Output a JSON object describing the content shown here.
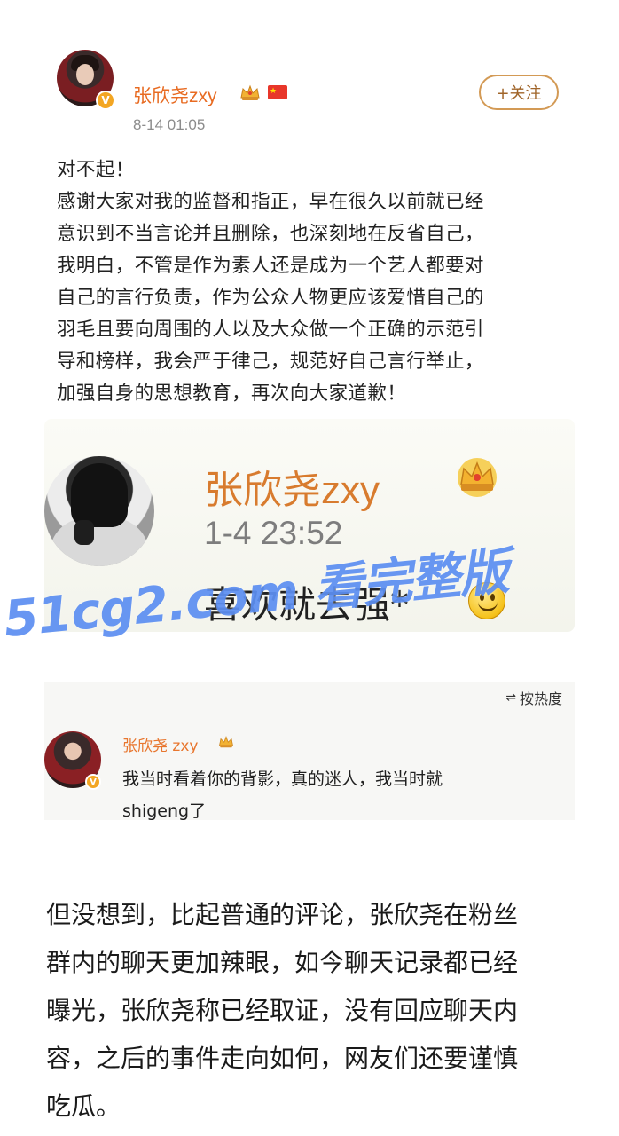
{
  "post": {
    "username": "张欣尧zxy",
    "timestamp": "8-14 01:05",
    "follow_label": "+关注",
    "verified_badge": "V",
    "crown_icon": "crown-icon",
    "flag_icon": "china-flag-icon",
    "body_lines": [
      "对不起！",
      "感谢大家对我的监督和指正，早在很久以前就已经",
      "意识到不当言论并且删除，也深刻地在反省自己，",
      "我明白，不管是作为素人还是成为一个艺人都要对",
      "自己的言行负责，作为公众人物更应该爱惜自己的",
      "羽毛且要向周围的人以及大众做一个正确的示范引",
      "导和榜样，我会严于律己，规范好自己言行举止，",
      "加强自身的思想教育，再次向大家道歉！"
    ]
  },
  "old_post": {
    "username": "张欣尧zxy",
    "timestamp": "1-4 23:52",
    "text": "喜欢就去强*"
  },
  "watermark": {
    "text": "51cg2.com 看完整版"
  },
  "comment": {
    "sort_label": "按热度",
    "username": "张欣尧 zxy",
    "verified_badge": "V",
    "lines": [
      "我当时看着你的背影，真的迷人，我当时就",
      "shigeng了"
    ]
  },
  "article": {
    "lines": [
      "但没想到，比起普通的评论，张欣尧在粉丝",
      "群内的聊天更加辣眼，如今聊天记录都已经",
      "曝光，张欣尧称已经取证，没有回应聊天内",
      "容，之后的事件走向如何，网友们还要谨慎",
      "吃瓜。"
    ]
  },
  "colors": {
    "username_orange": "#e86b22",
    "follow_border": "#d39a55",
    "watermark_blue": "#5d8ff2",
    "badge_gold": "#f3a623"
  }
}
